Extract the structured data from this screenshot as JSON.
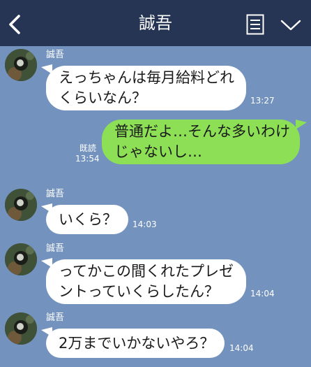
{
  "header": {
    "title": "誠吾",
    "back_icon": "chevron-left-icon",
    "menu_icon": "notes-icon",
    "collapse_icon": "chevron-down-icon",
    "bar_color": "#263554"
  },
  "chat": {
    "background_color": "#7393be",
    "incoming_bubble_color": "#ffffff",
    "outgoing_bubble_color": "#8de055",
    "messages": [
      {
        "sender": "誠吾",
        "lines": [
          "えっちゃんは毎月給料どれ",
          "くらいなん？"
        ],
        "time": "13:27"
      },
      {
        "sender": "me",
        "lines": [
          "普通だよ…そんな多いわけ",
          "じゃないし…"
        ],
        "read": "既読",
        "time": "13:54"
      },
      {
        "sender": "誠吾",
        "lines": [
          "いくら？"
        ],
        "time": "14:03"
      },
      {
        "sender": "誠吾",
        "lines": [
          "ってかこの間くれたプレゼ",
          "ントっていくらしたん？"
        ],
        "time": "14:04"
      },
      {
        "sender": "誠吾",
        "lines": [
          "2万までいかないやろ？"
        ],
        "time": "14:04"
      }
    ]
  }
}
